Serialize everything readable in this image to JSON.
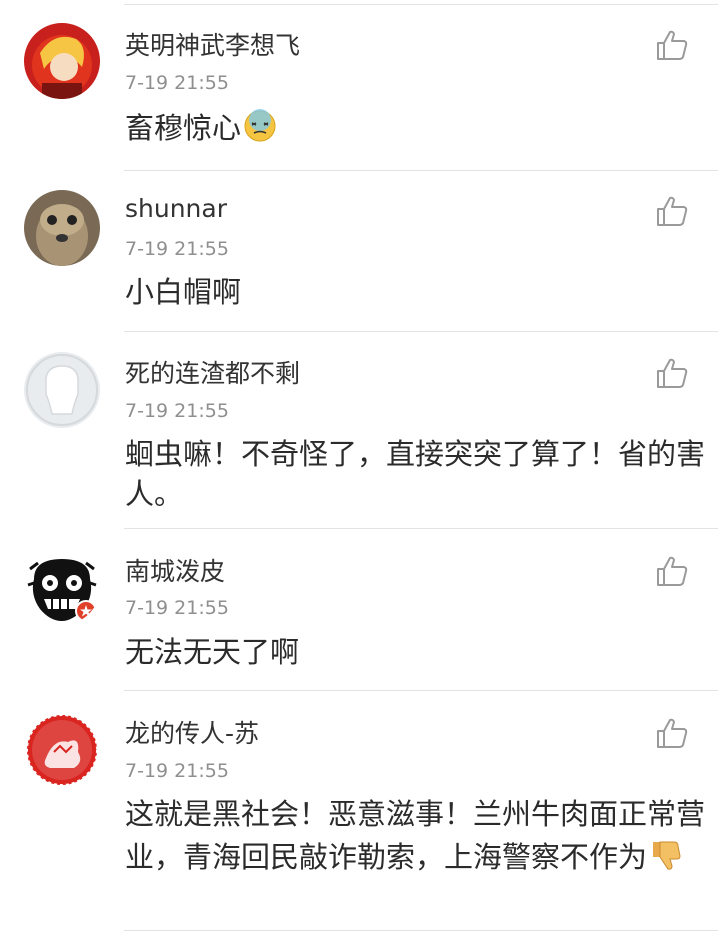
{
  "comments": [
    {
      "user": "英明神武李想飞",
      "time": "7-19 21:55",
      "text": "畜穆惊心",
      "emoji": "dizzy-face-emoji"
    },
    {
      "user": "shunnar",
      "time": "7-19 21:55",
      "text": "小白帽啊"
    },
    {
      "user": "死的连渣都不剩",
      "time": "7-19 21:55",
      "text": "蛔虫嘛！不奇怪了，直接突突了算了！省的害人。"
    },
    {
      "user": "南城泼皮",
      "time": "7-19 21:55",
      "text": "无法无天了啊"
    },
    {
      "user": "龙的传人-苏",
      "time": "7-19 21:55",
      "text": "这就是黑社会！恶意滋事！兰州牛肉面正常营业，青海回民敲诈勒索，上海警察不作为",
      "emoji": "thumbs-down-emoji"
    }
  ],
  "icons": {
    "like": "thumbs-up-outline-icon"
  },
  "colors": {
    "text": "#2b2b2b",
    "meta": "#8f8f8f",
    "icon": "#9a9a9a",
    "divider": "#e3e3e3"
  }
}
